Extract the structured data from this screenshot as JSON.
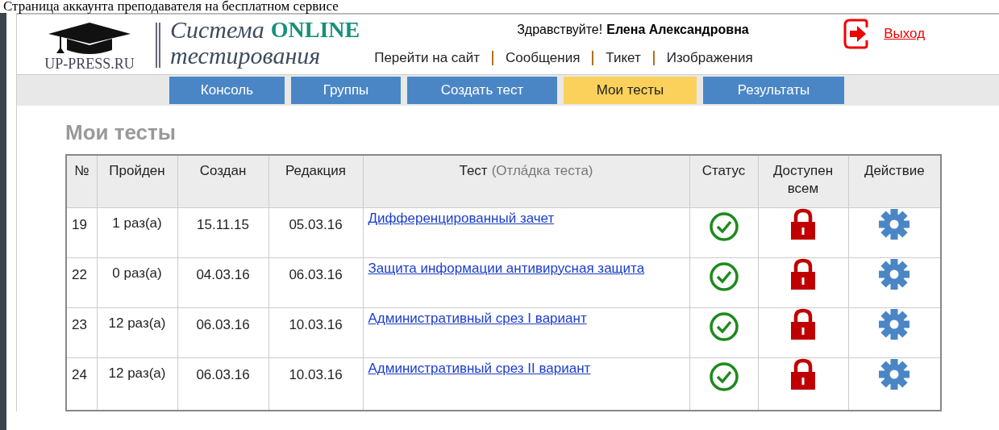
{
  "caption": "Страница аккаунта преподавателя на бесплатном сервисе",
  "logo": {
    "text": "UP-PRESS.RU"
  },
  "site_title": {
    "line_1": "Система",
    "accent": "ONLINE",
    "line_2": "тестирования"
  },
  "greeting": {
    "text": "Здравствуйте!",
    "user": "Елена Александровна"
  },
  "top_links": [
    "Перейти на сайт",
    "Сообщения",
    "Тикет",
    "Изображения"
  ],
  "logout": "Выход",
  "tabs": [
    {
      "label": "Консоль",
      "selected": false
    },
    {
      "label": "Группы",
      "selected": false
    },
    {
      "label": "Создать тест",
      "selected": false
    },
    {
      "label": "Мои тесты",
      "selected": true
    },
    {
      "label": "Результаты",
      "selected": false
    }
  ],
  "page_title": "Мои тесты",
  "table": {
    "columns": [
      {
        "label": "№"
      },
      {
        "label": "Пройден"
      },
      {
        "label": "Создан"
      },
      {
        "label": "Редакция"
      },
      {
        "label": "Тест",
        "note": "(Отла́дка теста)"
      },
      {
        "label": "Статус"
      },
      {
        "label": "Доступен всем"
      },
      {
        "label": "Действие"
      }
    ],
    "rows": [
      {
        "number": "19",
        "passed": "1 раз(а)",
        "created": "15.11.15",
        "edited": "05.03.16",
        "test": "Дифференцированный зачет",
        "active": true,
        "public": false
      },
      {
        "number": "22",
        "passed": "0 раз(а)",
        "created": "04.03.16",
        "edited": "06.03.16",
        "test": "Защита информации антивирусная защита",
        "active": true,
        "public": false
      },
      {
        "number": "23",
        "passed": "12 раз(а)",
        "created": "06.03.16",
        "edited": "10.03.16",
        "test": "Административный срез I вариант",
        "active": true,
        "public": false
      },
      {
        "number": "24",
        "passed": "12 раз(а)",
        "created": "06.03.16",
        "edited": "10.03.16",
        "test": "Административный срез II вариант",
        "active": true,
        "public": false
      }
    ]
  }
}
